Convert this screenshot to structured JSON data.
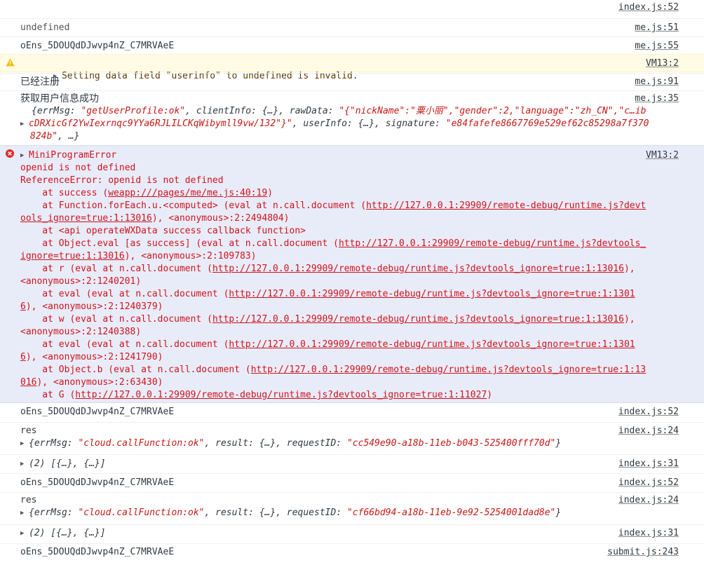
{
  "messages": {
    "m0": {
      "source": "index.js:52"
    },
    "m1": {
      "text": "undefined",
      "source": "me.js:51"
    },
    "m2": {
      "text": "oEns_5DOUQdDJwvp4nZ_C7MRVAeE",
      "source": "me.js:55"
    },
    "m3": {
      "text": "Setting data field \"userinfo\" to undefined is invalid.",
      "source": "VM13:2"
    },
    "m4": {
      "text": "已经注册",
      "source": "me.js:91"
    },
    "m5": {
      "text": "获取用户信息成功",
      "source": "me.js:35",
      "l1": {
        "p1": "{errMsg: ",
        "v1": "\"getUserProfile:ok\"",
        "p2": ", clientInfo: {…}, rawData: ",
        "v2a": "\"{\"nickName\":\"",
        "v2b": "粟小丽",
        "v2c": "\",\"gender\":2,\"language\":\"zh_CN\",\"c…ib"
      },
      "l2": {
        "v1": "cDRXicGf2YwIexrnqc9YYa6RJLILCKqWibymll9vw/132\"}\"",
        "p1": ", userInfo: {…}, signature: ",
        "v2": "\"e84fafefe8667769e529ef62c85298a7f370"
      },
      "l3": {
        "v1": "824b\"",
        "p1": ", …}"
      }
    },
    "m6": {
      "title": "MiniProgramError",
      "source": "VM13:2",
      "line1": "openid is not defined",
      "line2": "ReferenceError: openid is not defined",
      "s1": {
        "a": "    at success (",
        "link": "weapp:///pages/me/me.js:40:19",
        "b": ")"
      },
      "s2a": {
        "a": "    at Function.forEach.u.<computed> (eval at n.call.document (",
        "link": "http://127.0.0.1:29909/remote-debug/runtime.js?devt"
      },
      "s2b": {
        "link": "ools_ignore=true:1:13016",
        "b": "), <anonymous>:2:2494804)"
      },
      "s3": {
        "a": "    at <api operateWXData success callback function>"
      },
      "s4a": {
        "a": "    at Object.eval [as success] (eval at n.call.document (",
        "link": "http://127.0.0.1:29909/remote-debug/runtime.js?devtools_"
      },
      "s4b": {
        "link": "ignore=true:1:13016",
        "b": "), <anonymous>:2:109783)"
      },
      "s5a": {
        "a": "    at r (eval at n.call.document (",
        "link": "http://127.0.0.1:29909/remote-debug/runtime.js?devtools_ignore=true:1:13016",
        "b": "),"
      },
      "s5b": {
        "a": "<anonymous>:2:1240201)"
      },
      "s6a": {
        "a": "    at eval (eval at n.call.document (",
        "link": "http://127.0.0.1:29909/remote-debug/runtime.js?devtools_ignore=true:1:1301"
      },
      "s6b": {
        "link": "6",
        "b": "), <anonymous>:2:1240379)"
      },
      "s7a": {
        "a": "    at w (eval at n.call.document (",
        "link": "http://127.0.0.1:29909/remote-debug/runtime.js?devtools_ignore=true:1:13016",
        "b": "),"
      },
      "s7b": {
        "a": "<anonymous>:2:1240388)"
      },
      "s8a": {
        "a": "    at eval (eval at n.call.document (",
        "link": "http://127.0.0.1:29909/remote-debug/runtime.js?devtools_ignore=true:1:1301"
      },
      "s8b": {
        "link": "6",
        "b": "), <anonymous>:2:1241790)"
      },
      "s9a": {
        "a": "    at Object.b (eval at n.call.document (",
        "link": "http://127.0.0.1:29909/remote-debug/runtime.js?devtools_ignore=true:1:13"
      },
      "s9b": {
        "link": "016",
        "b": "), <anonymous>:2:63430)"
      },
      "s10": {
        "a": "    at G (",
        "link": "http://127.0.0.1:29909/remote-debug/runtime.js?devtools_ignore=true:1:11027",
        "b": ")"
      }
    },
    "m7": {
      "text": "oEns_5DOUQdDJwvp4nZ_C7MRVAeE",
      "source": "index.js:52"
    },
    "m8": {
      "text": "res",
      "source": "index.js:24",
      "p1": "{errMsg: ",
      "v1": "\"cloud.callFunction:ok\"",
      "p2": ", result: {…}, requestID: ",
      "v2": "\"cc549e90-a18b-11eb-b043-525400fff70d\"",
      "p3": "}"
    },
    "m9": {
      "text": "(2) [{…}, {…}]",
      "source": "index.js:31"
    },
    "m10": {
      "text": "oEns_5DOUQdDJwvp4nZ_C7MRVAeE",
      "source": "index.js:52"
    },
    "m11": {
      "text": "res",
      "source": "index.js:24",
      "p1": "{errMsg: ",
      "v1": "\"cloud.callFunction:ok\"",
      "p2": ", result: {…}, requestID: ",
      "v2": "\"cf66bd94-a18b-11eb-9e92-5254001dad8e\"",
      "p3": "}"
    },
    "m12": {
      "text": "(2) [{…}, {…}]",
      "source": "index.js:31"
    },
    "m13": {
      "text": "oEns_5DOUQdDJwvp4nZ_C7MRVAeE",
      "source": "submit.js:243"
    }
  },
  "icons": {
    "expand": "triangle-right-icon",
    "warning": "warning-icon",
    "error": "error-icon"
  },
  "colors": {
    "error_text": "#d0131d",
    "string_value": "#c41a16",
    "warning_bg": "#fffbe5",
    "error_bg": "#e8ecf8"
  }
}
